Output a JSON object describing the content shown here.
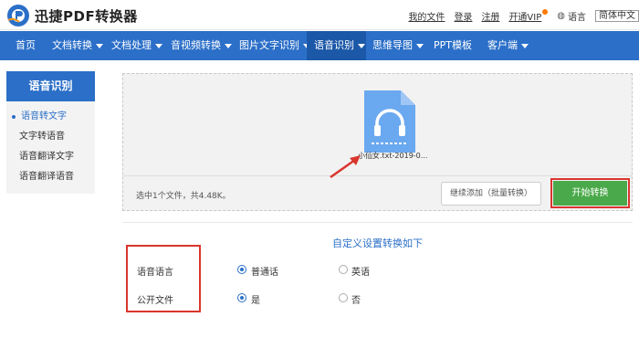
{
  "header": {
    "brand": "迅捷PDF转换器",
    "links": {
      "my_files": "我的文件",
      "login": "登录",
      "register": "注册",
      "open_vip": "开通VIP",
      "language": "语言",
      "lang_option": "简体中文"
    }
  },
  "nav": {
    "items": [
      {
        "label": "首页",
        "dropdown": false
      },
      {
        "label": "文档转换",
        "dropdown": true
      },
      {
        "label": "文档处理",
        "dropdown": true
      },
      {
        "label": "音视频转换",
        "dropdown": true
      },
      {
        "label": "图片文字识别",
        "dropdown": true
      },
      {
        "label": "语音识别",
        "dropdown": true,
        "active": true
      },
      {
        "label": "思维导图",
        "dropdown": true
      },
      {
        "label": "PPT模板",
        "dropdown": false
      },
      {
        "label": "客户端",
        "dropdown": true
      }
    ]
  },
  "sidebar": {
    "title": "语音识别",
    "items": [
      {
        "label": "语音转文字",
        "active": true
      },
      {
        "label": "文字转语音",
        "active": false
      },
      {
        "label": "语音翻译文字",
        "active": false
      },
      {
        "label": "语音翻译语音",
        "active": false
      }
    ]
  },
  "upload": {
    "file_name": "小仙女.txt-2019-0...",
    "status": "选中1个文件，共4.48K。",
    "add_button": "继续添加（批量转换）",
    "start_button": "开始转换"
  },
  "settings": {
    "title": "自定义设置转换如下",
    "rows": [
      {
        "label": "语音语言",
        "options": [
          "普通话",
          "英语"
        ],
        "selected": 0
      },
      {
        "label": "公开文件",
        "options": [
          "是",
          "否"
        ],
        "selected": 0
      }
    ]
  },
  "colors": {
    "primary": "#2b6fc8",
    "nav_active": "#1c58a8",
    "start_button": "#4aa94a",
    "highlight": "#d9362e"
  },
  "icons": {
    "logo": "logo-icon",
    "file": "audio-file-icon",
    "arrow": "annotation-arrow-icon",
    "globe": "globe-icon"
  }
}
